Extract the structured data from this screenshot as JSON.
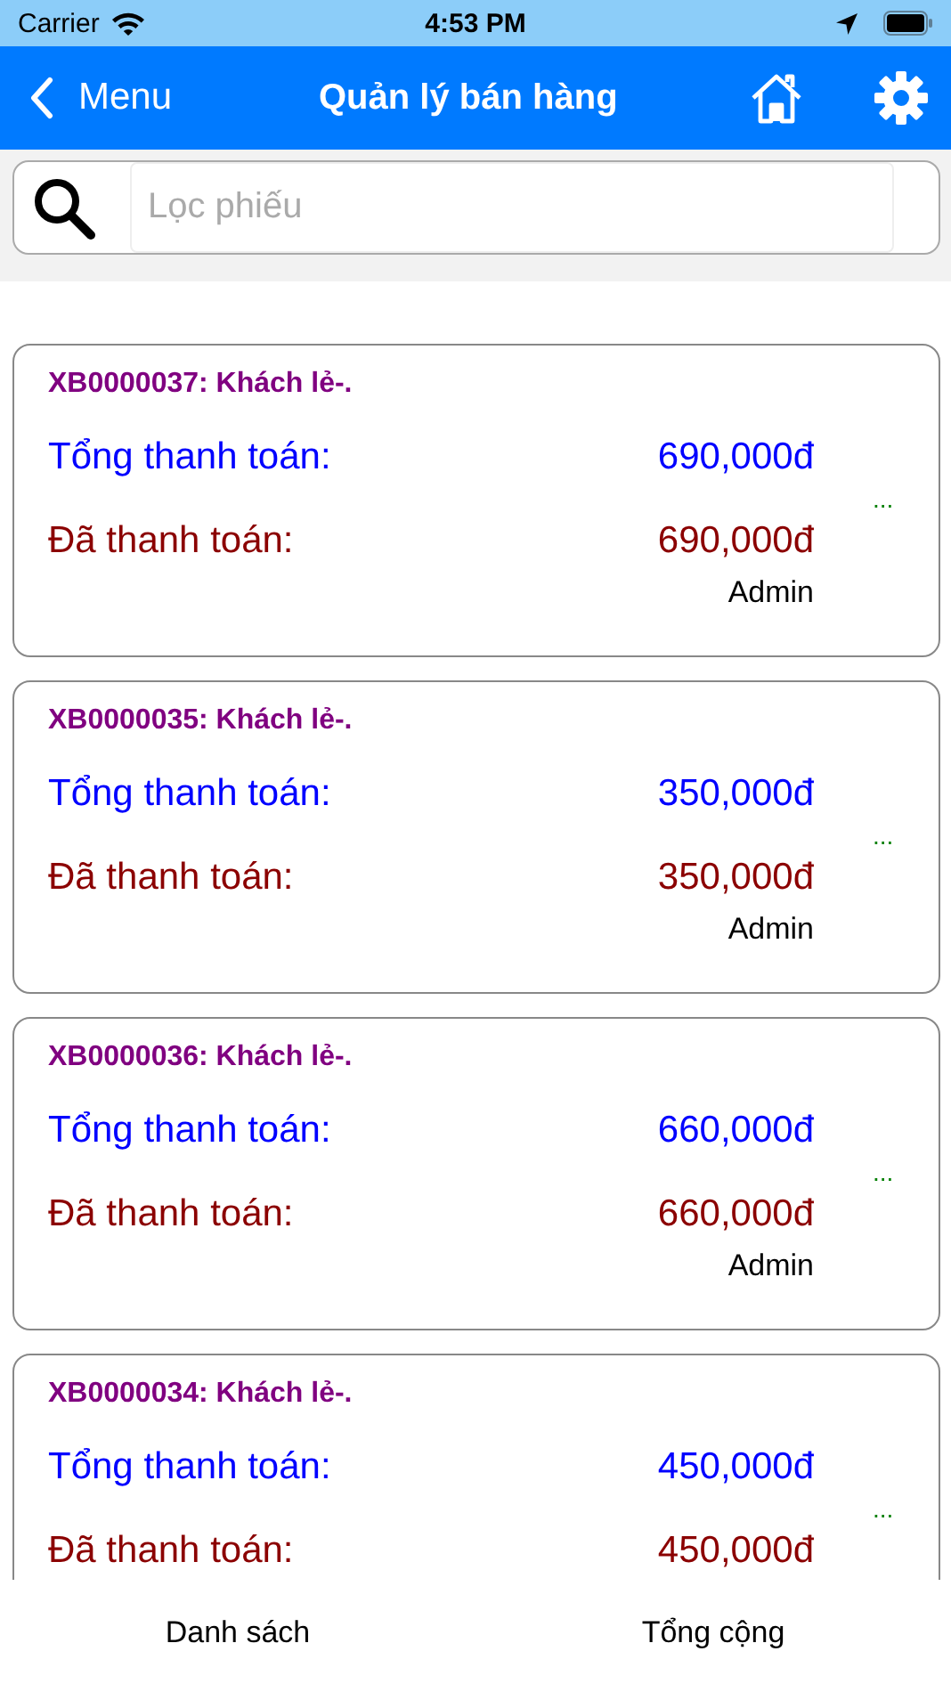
{
  "status_bar": {
    "carrier": "Carrier",
    "time": "4:53 PM"
  },
  "nav_bar": {
    "back_label": "Menu",
    "title": "Quản lý bán hàng"
  },
  "search": {
    "placeholder": "Lọc phiếu"
  },
  "receipts": [
    {
      "title": "XB0000037: Khách lẻ-.",
      "total_label": "Tổng thanh toán:",
      "total": "690,000đ",
      "paid_label": "Đã thanh toán:",
      "paid": "690,000đ",
      "more": "...",
      "user": "Admin"
    },
    {
      "title": "XB0000035: Khách lẻ-.",
      "total_label": "Tổng thanh toán:",
      "total": "350,000đ",
      "paid_label": "Đã thanh toán:",
      "paid": "350,000đ",
      "more": "...",
      "user": "Admin"
    },
    {
      "title": "XB0000036: Khách lẻ-.",
      "total_label": "Tổng thanh toán:",
      "total": "660,000đ",
      "paid_label": "Đã thanh toán:",
      "paid": "660,000đ",
      "more": "...",
      "user": "Admin"
    },
    {
      "title": "XB0000034: Khách lẻ-.",
      "total_label": "Tổng thanh toán:",
      "total": "450,000đ",
      "paid_label": "Đã thanh toán:",
      "paid": "450,000đ",
      "more": "..."
    }
  ],
  "tabs": [
    {
      "label": "Danh sách"
    },
    {
      "label": "Tổng cộng"
    }
  ]
}
